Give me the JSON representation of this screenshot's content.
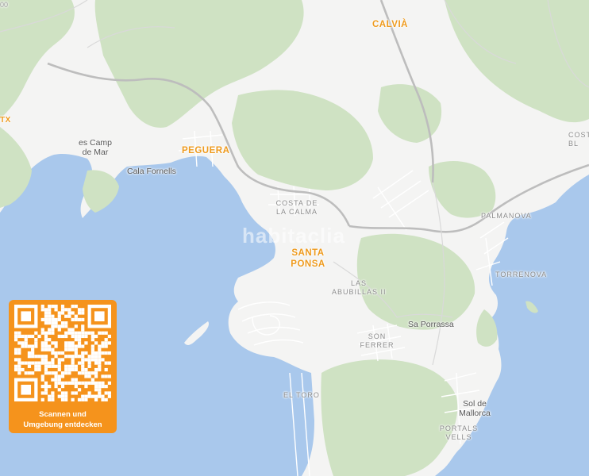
{
  "colors": {
    "water": "#a9c8ec",
    "land": "#f4f4f3",
    "vegetation": "#cfe2c3",
    "road": "#cfcfcf",
    "street": "#ffffff",
    "town_label": "#ee9a1d",
    "qr_card": "#f5931c"
  },
  "labels": {
    "calvia": "CALVIÀ",
    "peguera": "PEGUERA",
    "santa_ponsa_1": "SANTA",
    "santa_ponsa_2": "PONSA",
    "camp_de_mar_1": "es Camp",
    "camp_de_mar_2": "de Mar",
    "cala_fornells": "Cala Fornells",
    "costa_calma_1": "COSTA DE",
    "costa_calma_2": "LA CALMA",
    "palmanova": "PALMANOVA",
    "torrenova": "TORRENOVA",
    "abubilles_1": "LAS",
    "abubilles_2": "ABUBILLAS II",
    "sa_porrassa": "Sa Porrassa",
    "son_ferrer_1": "SON",
    "son_ferrer_2": "FERRER",
    "el_toro": "EL TORO",
    "sol_mallorca_1": "Sol de",
    "sol_mallorca_2": "Mallorca",
    "portals_1": "PORTALS",
    "portals_2": "VELLS",
    "costa_edge_1": "COST",
    "costa_edge_2": "BL",
    "left_edge": "TX",
    "corner_edge": "00"
  },
  "watermark": "habitaclia",
  "qr": {
    "icon": "qr-code-icon",
    "caption_line1": "Scannen und",
    "caption_line2": "Umgebung entdecken"
  }
}
